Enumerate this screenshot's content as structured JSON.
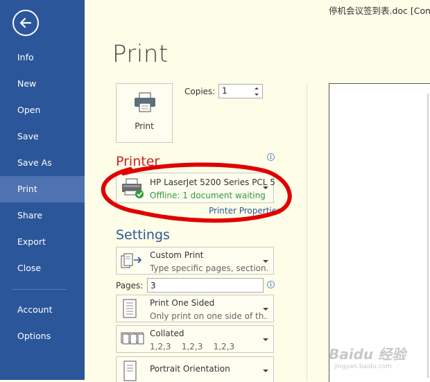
{
  "window": {
    "doc_title": "停机会议签到表.doc [Comp"
  },
  "nav": {
    "items": [
      {
        "label": "Info"
      },
      {
        "label": "New"
      },
      {
        "label": "Open"
      },
      {
        "label": "Save"
      },
      {
        "label": "Save As"
      },
      {
        "label": "Print",
        "active": true
      },
      {
        "label": "Share"
      },
      {
        "label": "Export"
      },
      {
        "label": "Close"
      },
      {
        "label": "Account"
      },
      {
        "label": "Options"
      }
    ]
  },
  "main": {
    "heading": "Print",
    "print_button_label": "Print",
    "copies_label": "Copies:",
    "copies_value": "1",
    "printer_section": "Printer",
    "printer": {
      "name": "HP LaserJet 5200 Series PCL 5",
      "status": "Offline: 1 document waiting",
      "status_color": "#2e9b3a"
    },
    "printer_properties": "Printer Properties",
    "settings_section": "Settings",
    "settings": {
      "range": {
        "title": "Custom Print",
        "sub": "Type specific pages, section..."
      },
      "pages_label": "Pages:",
      "pages_value": "3",
      "sides": {
        "title": "Print One Sided",
        "sub": "Only print on one side of th..."
      },
      "collation": {
        "title": "Collated",
        "sub": "1,2,3    1,2,3    1,2,3"
      },
      "orientation": {
        "title": "Portrait Orientation"
      }
    }
  },
  "colors": {
    "sidebar": "#2b569a",
    "sidebar_active": "#4f72b0",
    "accent": "#2b579a",
    "annotation": "#e00000"
  },
  "watermark": {
    "main": "Baidu 经验",
    "sub": "jingyan.baidu.com"
  }
}
